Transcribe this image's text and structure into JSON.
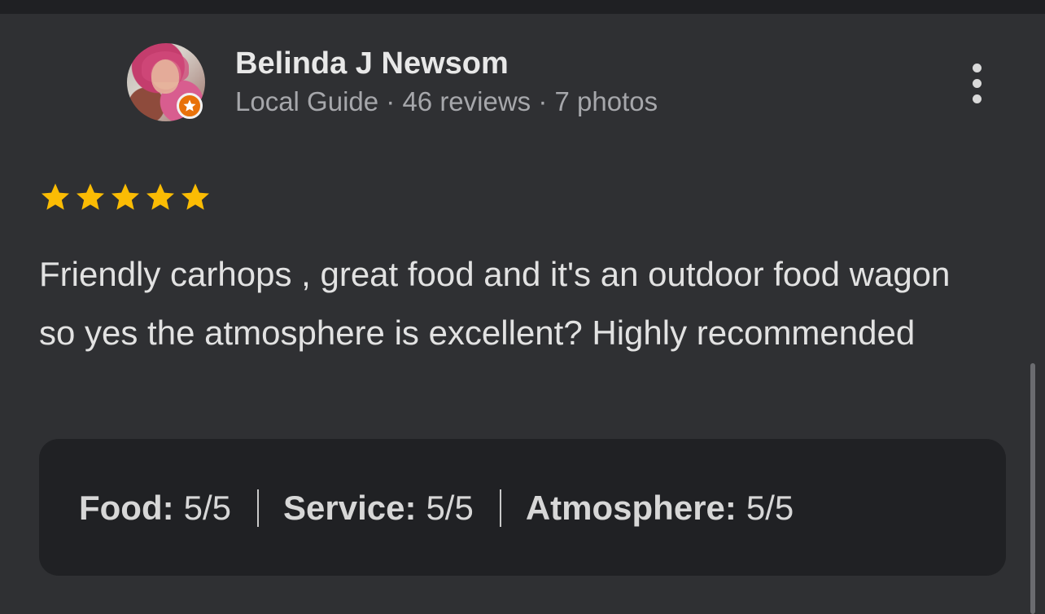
{
  "reviewer": {
    "name": "Belinda J Newsom",
    "meta": "Local Guide · 46 reviews · 7 photos",
    "badge_icon": "star-icon"
  },
  "review": {
    "rating": 5,
    "max_rating": 5,
    "star_color": "#fbbc04",
    "text": "Friendly carhops , great food and it's an outdoor food wagon so yes the atmosphere is excellent? Highly recommended"
  },
  "ratings": [
    {
      "label": "Food:",
      "value": "5/5"
    },
    {
      "label": "Service:",
      "value": "5/5"
    },
    {
      "label": "Atmosphere:",
      "value": "5/5"
    }
  ],
  "colors": {
    "background": "#2f3033",
    "ratings_box": "#202124",
    "badge": "#e8710a"
  }
}
